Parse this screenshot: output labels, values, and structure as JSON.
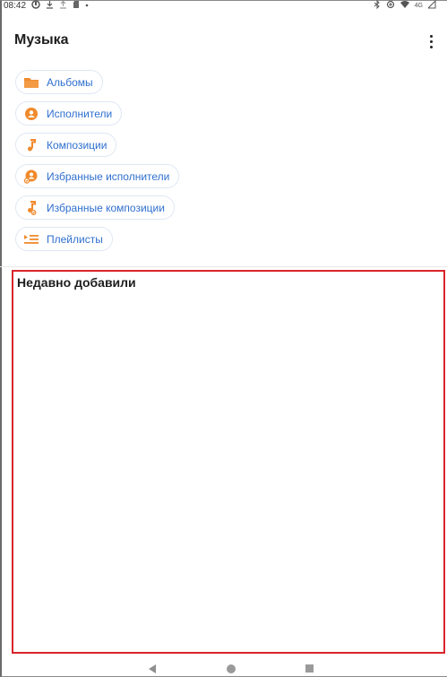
{
  "status_bar": {
    "time": "08:42",
    "network": "4G"
  },
  "app_bar": {
    "title": "Музыка"
  },
  "chips": [
    {
      "label": "Альбомы",
      "icon": "folder-icon"
    },
    {
      "label": "Исполнители",
      "icon": "person-icon"
    },
    {
      "label": "Композиции",
      "icon": "music-note-icon"
    },
    {
      "label": "Избранные исполнители",
      "icon": "favorite-artists-icon"
    },
    {
      "label": "Избранные композиции",
      "icon": "favorite-tracks-icon"
    },
    {
      "label": "Плейлисты",
      "icon": "playlist-icon"
    }
  ],
  "recent": {
    "title": "Недавно добавили"
  },
  "colors": {
    "accent": "#2f6fcf",
    "icon_orange": "#f08a2c",
    "highlight_border": "#d9242b",
    "chip_border": "#dfe7f3"
  }
}
